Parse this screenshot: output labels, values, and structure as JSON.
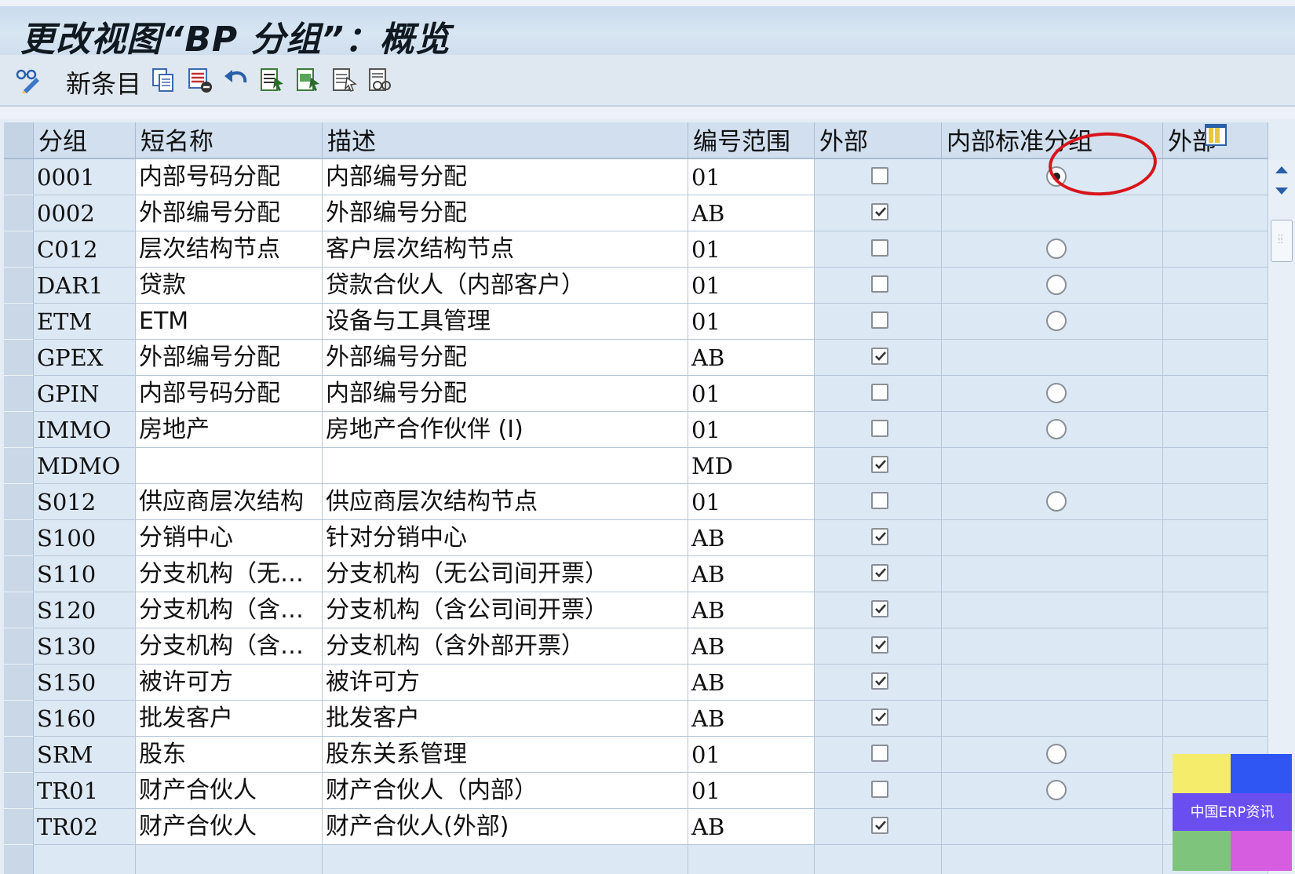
{
  "window": {
    "title": "更改视图“BP 分组”：概览"
  },
  "toolbar": {
    "new_entry_label": "新条目",
    "icons": [
      "display-change-icon",
      "copy-icon",
      "delete-icon",
      "undo-icon",
      "select-all-icon",
      "select-block-icon",
      "deselect-icon",
      "config-icon"
    ]
  },
  "table": {
    "columns": [
      "分组",
      "短名称",
      "描述",
      "编号范围",
      "外部",
      "内部标准分组",
      "外部"
    ],
    "rows": [
      {
        "group": "0001",
        "short": "内部号码分配",
        "desc": "内部编号分配",
        "range": "01",
        "external": false,
        "internal_std": "selected"
      },
      {
        "group": "0002",
        "short": "外部编号分配",
        "desc": "外部编号分配",
        "range": "AB",
        "external": true,
        "internal_std": "none"
      },
      {
        "group": "C012",
        "short": "层次结构节点",
        "desc": "客户层次结构节点",
        "range": "01",
        "external": false,
        "internal_std": "empty"
      },
      {
        "group": "DAR1",
        "short": "贷款",
        "desc": "贷款合伙人（内部客户）",
        "range": "01",
        "external": false,
        "internal_std": "empty"
      },
      {
        "group": "ETM",
        "short": "ETM",
        "desc": "设备与工具管理",
        "range": "01",
        "external": false,
        "internal_std": "empty"
      },
      {
        "group": "GPEX",
        "short": "外部编号分配",
        "desc": "外部编号分配",
        "range": "AB",
        "external": true,
        "internal_std": "none"
      },
      {
        "group": "GPIN",
        "short": "内部号码分配",
        "desc": "内部编号分配",
        "range": "01",
        "external": false,
        "internal_std": "empty"
      },
      {
        "group": "IMMO",
        "short": "房地产",
        "desc": "房地产合作伙伴 (I)",
        "range": "01",
        "external": false,
        "internal_std": "empty"
      },
      {
        "group": "MDMO",
        "short": "",
        "desc": "",
        "range": "MD",
        "external": true,
        "internal_std": "none"
      },
      {
        "group": "S012",
        "short": "供应商层次结构",
        "desc": "供应商层次结构节点",
        "range": "01",
        "external": false,
        "internal_std": "empty"
      },
      {
        "group": "S100",
        "short": "分销中心",
        "desc": "针对分销中心",
        "range": "AB",
        "external": true,
        "internal_std": "none"
      },
      {
        "group": "S110",
        "short": "分支机构（无公…",
        "desc": "分支机构（无公司间开票）",
        "range": "AB",
        "external": true,
        "internal_std": "none"
      },
      {
        "group": "S120",
        "short": "分支机构（含公…",
        "desc": "分支机构（含公司间开票）",
        "range": "AB",
        "external": true,
        "internal_std": "none"
      },
      {
        "group": "S130",
        "short": "分支机构（含外…",
        "desc": "分支机构（含外部开票）",
        "range": "AB",
        "external": true,
        "internal_std": "none"
      },
      {
        "group": "S150",
        "short": "被许可方",
        "desc": "被许可方",
        "range": "AB",
        "external": true,
        "internal_std": "none"
      },
      {
        "group": "S160",
        "short": "批发客户",
        "desc": "批发客户",
        "range": "AB",
        "external": true,
        "internal_std": "none"
      },
      {
        "group": "SRM",
        "short": "股东",
        "desc": "股东关系管理",
        "range": "01",
        "external": false,
        "internal_std": "empty"
      },
      {
        "group": "TR01",
        "short": "财产合伙人",
        "desc": "财产合伙人（内部）",
        "range": "01",
        "external": false,
        "internal_std": "empty"
      },
      {
        "group": "TR02",
        "short": "财产合伙人",
        "desc": "财产合伙人(外部)",
        "range": "AB",
        "external": true,
        "internal_std": "none"
      }
    ]
  },
  "watermark": {
    "text": "中国ERP资讯",
    "colors": [
      "#f4ec6a",
      "#2f55f3",
      "#6b4ef0",
      "#7ec47d",
      "#d65de0"
    ]
  },
  "annotation": {
    "color": "#d8141b"
  }
}
